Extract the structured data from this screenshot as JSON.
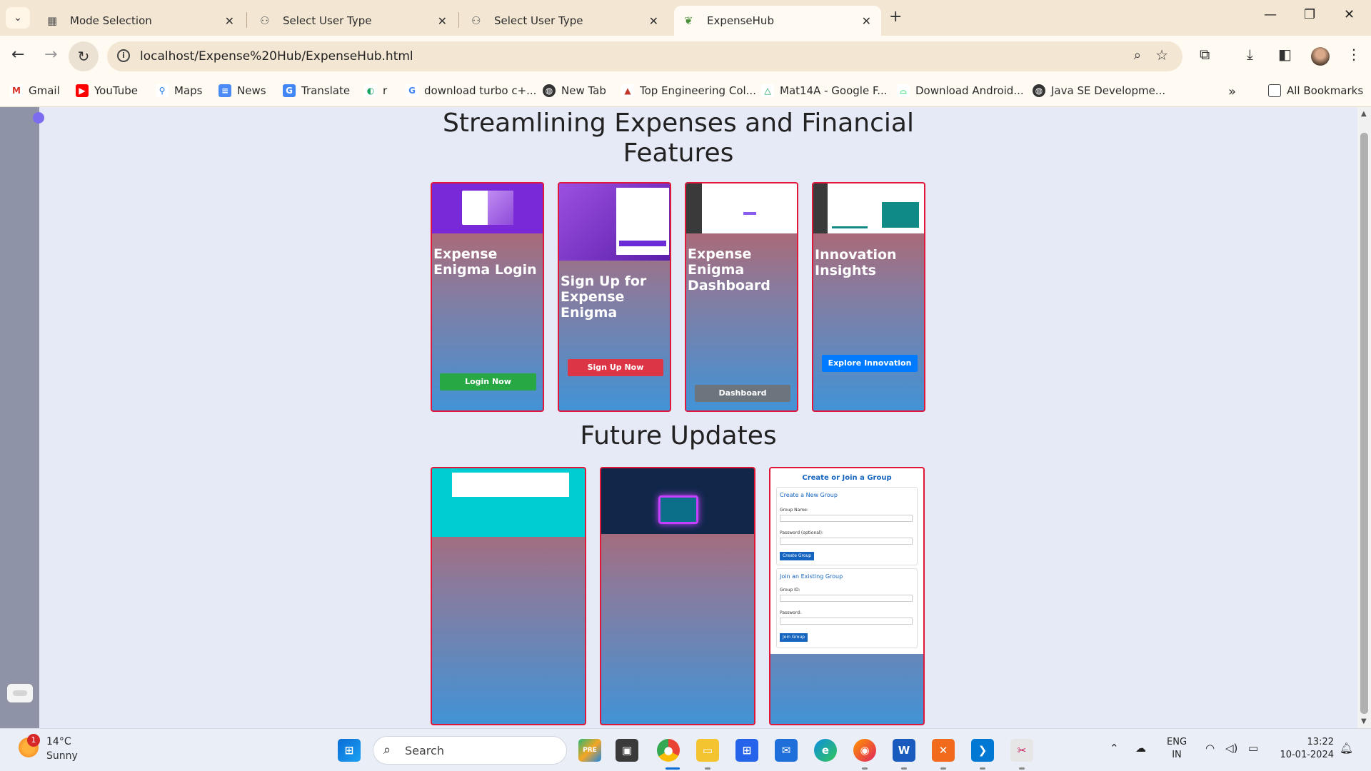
{
  "browser": {
    "tabs": [
      {
        "title": "Mode Selection",
        "icon": "grid-icon"
      },
      {
        "title": "Select User Type",
        "icon": "users-icon"
      },
      {
        "title": "Select User Type",
        "icon": "users-icon"
      },
      {
        "title": "ExpenseHub",
        "icon": "leaf-icon",
        "active": true
      }
    ],
    "url": "localhost/Expense%20Hub/ExpenseHub.html",
    "bookmarks": [
      "Gmail",
      "YouTube",
      "Maps",
      "News",
      "Translate",
      "r",
      "download turbo c+...",
      "New Tab",
      "Top Engineering Col...",
      "Mat14A - Google F...",
      "Download Android...",
      "Java SE Developme..."
    ],
    "all_bookmarks_label": "All Bookmarks"
  },
  "page": {
    "heading_line1": "Streamlining Expenses and Financial",
    "heading_line2": "Features",
    "future_heading": "Future Updates",
    "feature_cards": [
      {
        "title": "Expense Enigma Login",
        "button": "Login Now",
        "button_color": "#28a745"
      },
      {
        "title": "Sign Up for Expense Enigma",
        "button": "Sign Up Now",
        "button_color": "#dc3545"
      },
      {
        "title": "Expense Enigma Dashboard",
        "button": "Dashboard",
        "button_color": "#6c757d"
      },
      {
        "title": "Innovation Insights",
        "button": "Explore Innovation",
        "button_color": "#007bff"
      }
    ],
    "group_card": {
      "title": "Create or Join a Group",
      "create_heading": "Create a New Group",
      "group_name_label": "Group Name:",
      "password_optional_label": "Password (optional):",
      "create_button": "Create Group",
      "join_heading": "Join an Existing Group",
      "group_id_label": "Group ID:",
      "password_label": "Password:",
      "join_button": "Join Group"
    }
  },
  "taskbar": {
    "weather_temp": "14°C",
    "weather_condition": "Sunny",
    "weather_badge": "1",
    "search_placeholder": "Search",
    "lang_line1": "ENG",
    "lang_line2": "IN",
    "time": "13:22",
    "date": "10-01-2024"
  }
}
